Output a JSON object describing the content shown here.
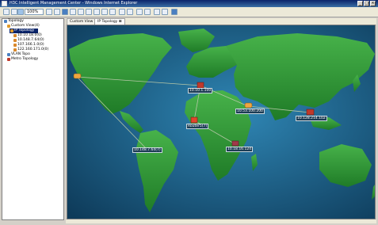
{
  "window": {
    "title": "H3C Intelligent Management Center - Windows Internet Explorer",
    "controls": [
      "_",
      "□",
      "×"
    ]
  },
  "toolbar": {
    "zoom_value": "100%",
    "buttons": [
      "back-icon",
      "forward-icon",
      "zoom-in-icon",
      "zoom-out-icon",
      "pointer-icon",
      "refresh-icon",
      "grid-icon",
      "grid-icon",
      "save-icon",
      "export-icon",
      "fit-icon",
      "layout-icon",
      "find-icon",
      "link-icon",
      "tools-icon",
      "help-icon"
    ]
  },
  "tree": {
    "root": "Topology",
    "custom_view": "Custom View(4)",
    "selected": "IP Topology",
    "ips": [
      "10.10.18.0(0)",
      "10.148.7.64(0)",
      "107.166.1.0(0)",
      "122.160.171.0(0)"
    ],
    "vlan": "VLAN Topo",
    "metro": "Metro Topology"
  },
  "tabs": [
    {
      "label": "Custom View"
    },
    {
      "label": "IP Topology"
    }
  ],
  "map": {
    "nodes": [
      {
        "id": "na",
        "label": ""
      },
      {
        "id": "eu",
        "label": "10.10.1.100"
      },
      {
        "id": "mideast",
        "label": "10.53.100.200"
      },
      {
        "id": "asia",
        "label": "10.128.214.102"
      },
      {
        "id": "africa_n",
        "label": "Router5(7)"
      },
      {
        "id": "africa_s",
        "label": "10.18.16.124"
      },
      {
        "id": "sa",
        "label": "10.148.7.64(7)"
      }
    ]
  },
  "colors": {
    "ocean": "#1c5b80",
    "land": "#2e9a32",
    "link": "#b6c7a7"
  }
}
